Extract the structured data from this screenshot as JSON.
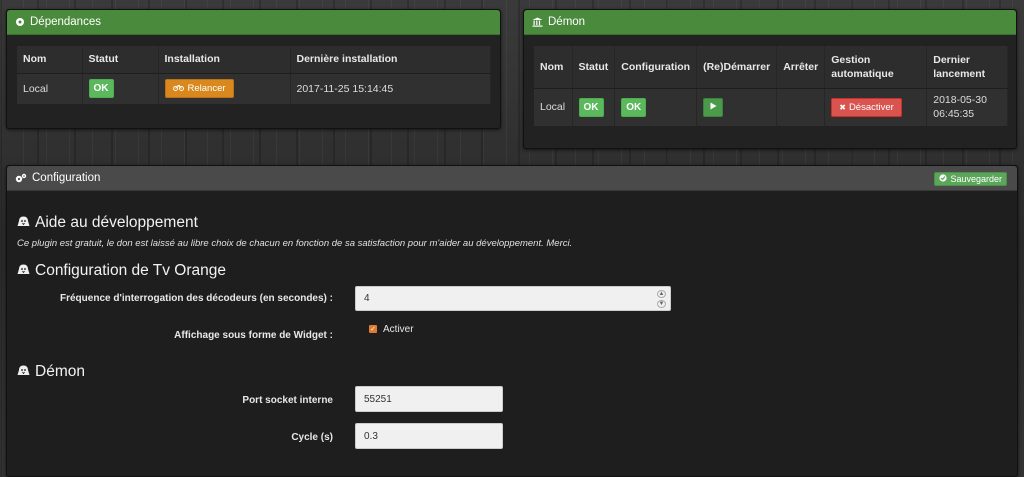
{
  "deps": {
    "title": "Dépendances",
    "headers": [
      "Nom",
      "Statut",
      "Installation",
      "Dernière installation"
    ],
    "row": {
      "name": "Local",
      "status": "OK",
      "install_button": "Relancer",
      "last_install": "2017-11-25 15:14:45"
    }
  },
  "daemon": {
    "title": "Démon",
    "headers": {
      "nom": "Nom",
      "statut": "Statut",
      "configuration": "Configuration",
      "redemarrer": "(Re)Démarrer",
      "arreter": "Arrêter",
      "gestion_line1": "Gestion",
      "gestion_line2": "automatique",
      "dernier_line1": "Dernier",
      "dernier_line2": "lancement"
    },
    "row": {
      "name": "Local",
      "status": "OK",
      "configuration": "OK",
      "auto_button": "Désactiver",
      "last_launch_line1": "2018-05-30",
      "last_launch_line2": "06:45:35"
    }
  },
  "config": {
    "title": "Configuration",
    "save_button": "Sauvegarder",
    "sections": {
      "aide_title": "Aide au développement",
      "aide_text": "Ce plugin est gratuit, le don est laissé au libre choix de chacun en fonction de sa satisfaction pour m'aider au développement. Merci.",
      "tv_title": "Configuration de Tv Orange",
      "demon_title": "Démon"
    },
    "fields": {
      "frequency_label": "Fréquence d'interrogation des décodeurs (en secondes) :",
      "frequency_value": "4",
      "widget_label": "Affichage sous forme de Widget :",
      "widget_checkbox_label": "Activer",
      "widget_checked": true,
      "port_label": "Port socket interne",
      "port_value": "55251",
      "cycle_label": "Cycle (s)",
      "cycle_value": "0.3"
    }
  },
  "colors": {
    "panel_green": "#4a8a3c",
    "ok_green": "#5cb85c",
    "orange": "#d9881e",
    "danger": "#d9534f"
  },
  "icons": {
    "deps": "gear-icon",
    "daemon": "bank-icon",
    "config": "cogs-icon",
    "section": "vader-icon"
  }
}
